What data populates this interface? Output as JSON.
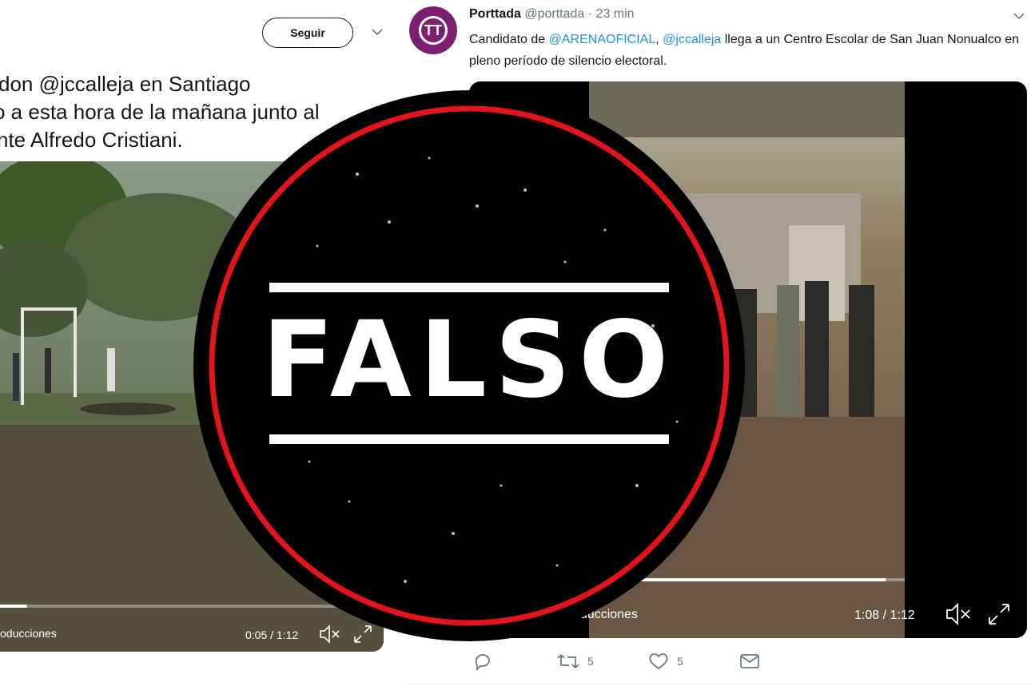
{
  "left_tweet": {
    "follow_label": "Seguir",
    "text_lines": [
      "don @jccalleja en Santiago",
      "o a esta hora de la mañana junto al",
      "nte Alfredo Cristiani."
    ],
    "video": {
      "caption": "oducciones",
      "time": "0:05 / 1:12",
      "progress": 0.07
    }
  },
  "right_tweet": {
    "avatar_initials": "TT",
    "author_name": "Porttada",
    "author_handle": "@porttada",
    "separator": "·",
    "timestamp": "23 min",
    "text": {
      "t1": "Candidato de ",
      "m1": "@ARENAOFICIAL",
      "t2": ",  ",
      "m2": "@jccalleja",
      "t3": " llega a un Centro Escolar de San Juan Nonualco en pleno período de silencio electoral."
    },
    "video": {
      "caption": "oducciones",
      "time": "1:08 / 1:12",
      "progress": 0.94
    },
    "actions": {
      "replies": "",
      "retweets": "5",
      "likes": "5"
    }
  },
  "stamp": {
    "label": "FALSO",
    "colors": {
      "ring": "#e3141b",
      "fill": "#000000",
      "text": "#ffffff"
    }
  },
  "icons": [
    "chevron-down-icon",
    "mute-icon",
    "fullscreen-icon",
    "reply-icon",
    "retweet-icon",
    "like-icon",
    "message-icon"
  ]
}
